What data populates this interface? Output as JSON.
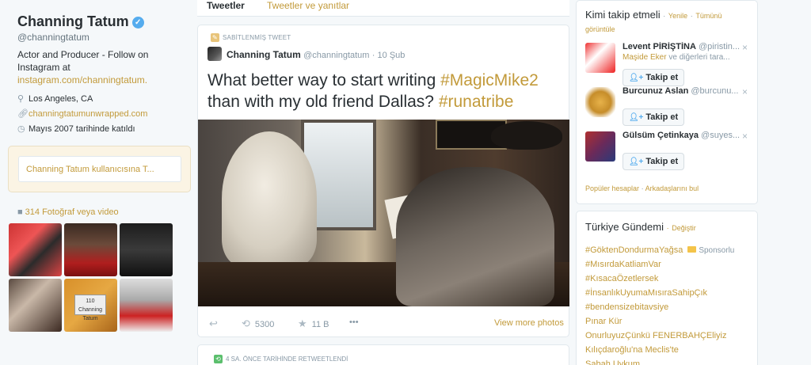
{
  "profile": {
    "name": "Channing Tatum",
    "verified_mark": "✓",
    "handle": "@channingtatum",
    "bio_text": "Actor and Producer - Follow on Instagram at",
    "bio_link": "instagram.com/channingtatum.",
    "location": "Los Angeles, CA",
    "website": "channingtatumunwrapped.com",
    "joined": "Mayıs 2007 tarihinde katıldı",
    "icons": {
      "location": "map-pin-icon",
      "website": "link-icon",
      "joined": "calendar-icon"
    }
  },
  "tweet_box": {
    "placeholder": "Channing Tatum kullanıcısına T..."
  },
  "media": {
    "label": "314 Fotoğraf veya video",
    "icon": "camera-icon",
    "thumb_plate_number": "110",
    "thumb_plate_name": "Channing Tatum"
  },
  "tabs": [
    {
      "label": "Tweetler",
      "active": true
    },
    {
      "label": "Tweetler ve yanıtlar",
      "active": false
    }
  ],
  "pinned_tweet": {
    "pinned_label": "SABİTLENMİŞ TWEET",
    "author_name": "Channing Tatum",
    "author_handle": "@channingtatum",
    "date": "10 Şub",
    "text_part1": "What better way to start writing ",
    "hashtag1": "#MagicMike2",
    "text_part2": " than with my old friend Dallas? ",
    "hashtag2": "#runatribe",
    "retweets": "5300",
    "favorites": "11 B",
    "more_label": "•••",
    "view_photos": "View more photos"
  },
  "next_tweet": {
    "retweet_note": "4 SA. ÖNCE TARİHİNDE RETWEETLENDİ"
  },
  "who_to_follow": {
    "title": "Kimi takip etmeli",
    "refresh": "Yenile",
    "view_all": "Tümünü görüntüle",
    "separator": "·",
    "close_mark": "×",
    "follow_label": "Takip et",
    "suggestions": [
      {
        "name": "Levent PİRİŞTİNA",
        "handle": "@piristin...",
        "sub_link": "Maşide Eker",
        "sub_text": " ve diğerleri tara..."
      },
      {
        "name": "Burcunuz Aslan",
        "handle": "@burcunu...",
        "sub_link": "",
        "sub_text": ""
      },
      {
        "name": "Gülsüm Çetinkaya",
        "handle": "@suyes...",
        "sub_link": "",
        "sub_text": ""
      }
    ],
    "footer_popular": "Popüler hesaplar",
    "footer_friends": "Arkadaşlarını bul"
  },
  "trends": {
    "title": "Türkiye Gündemi",
    "change": "Değiştir",
    "sponsored_label": "Sponsorlu",
    "items": [
      "#GöktenDondurmaYağsa",
      "#MısırdaKatliamVar",
      "#KısacaÖzetlersek",
      "#İnsanlıkUyumaMısıraSahipÇık",
      "#bendensizebitavsiye",
      "Pınar Kür",
      "OnurluyuzÇünkü FENERBAHÇEliyiz",
      "Kılıçdaroğlu'na Meclis'te",
      "Sabah Uykum"
    ]
  },
  "colors": {
    "link": "#c29a3a",
    "verified": "#55acee",
    "muted": "#8899a6",
    "text": "#292f33"
  }
}
